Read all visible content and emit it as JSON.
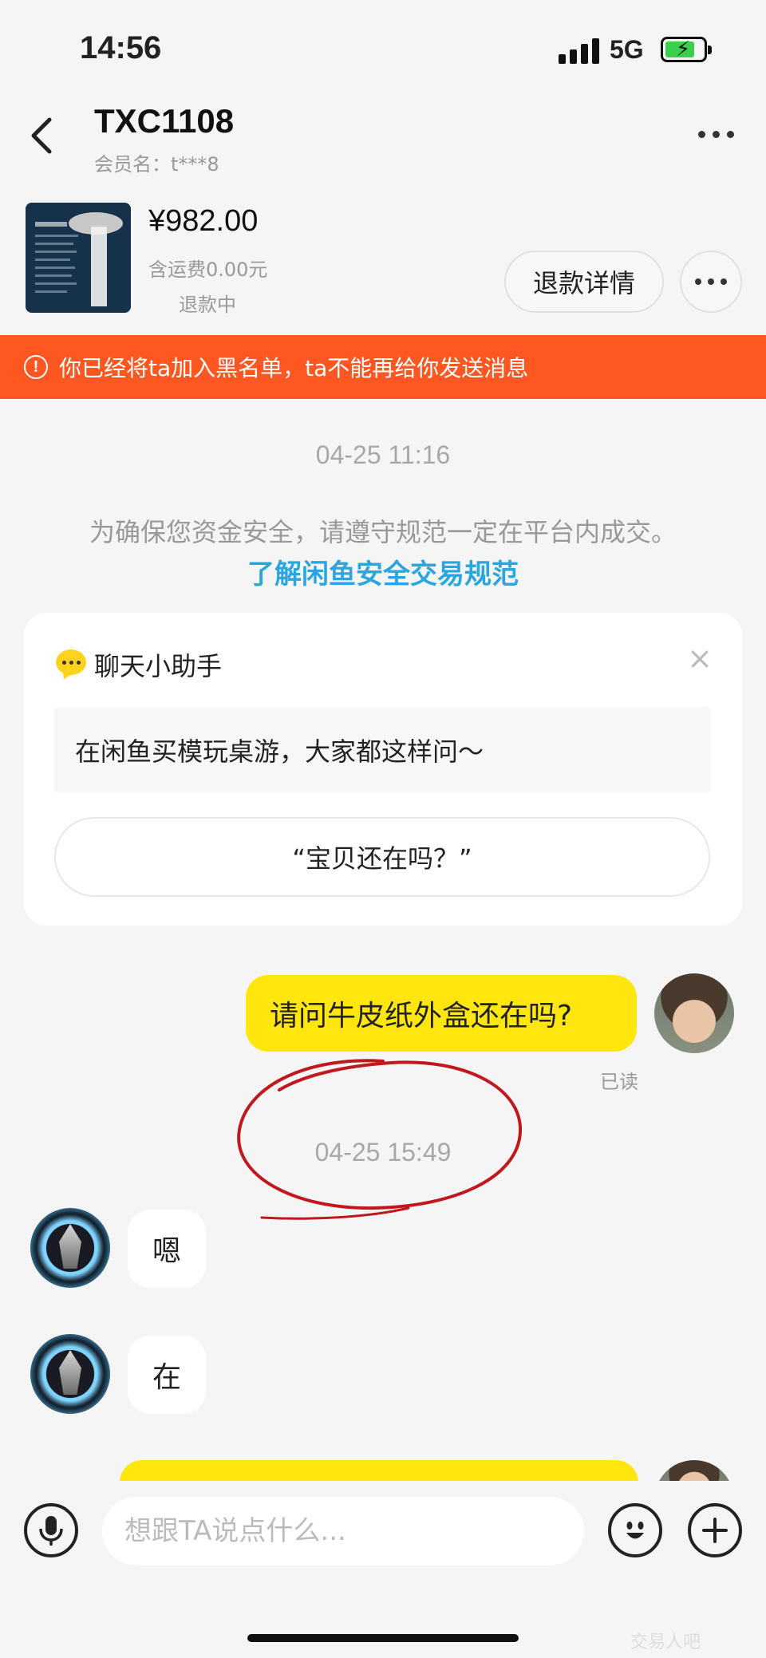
{
  "status_bar": {
    "time": "14:56",
    "network": "5G"
  },
  "header": {
    "title": "TXC1108",
    "member_label": "会员名：t***8"
  },
  "product": {
    "price": "¥982.00",
    "shipping": "含运费0.00元",
    "status": "退款中",
    "refund_button": "退款详情"
  },
  "banner": {
    "text": "你已经将ta加入黑名单，ta不能再给你发送消息",
    "color": "#ff5722"
  },
  "chat": {
    "time_1": "04-25 11:16",
    "safety_notice": "为确保您资金安全，请遵守规范一定在平台内成交。",
    "safety_link": "了解闲鱼安全交易规范",
    "helper": {
      "title": "聊天小助手",
      "prompt": "在闲鱼买模玩桌游，大家都这样问～",
      "suggestion": "“宝贝还在吗？”"
    },
    "messages": [
      {
        "from": "me",
        "text": "请问牛皮纸外盒还在吗?",
        "read": "已读"
      },
      {
        "from": "other",
        "text": "嗯"
      },
      {
        "from": "other",
        "text": "在"
      }
    ],
    "time_2": "04-25 15:49"
  },
  "input": {
    "placeholder": "想跟TA说点什么..."
  },
  "watermark": "交易人吧",
  "colors": {
    "accent_yellow": "#ffe60f",
    "link_blue": "#2ba5de",
    "annotation_red": "#c0181c"
  }
}
